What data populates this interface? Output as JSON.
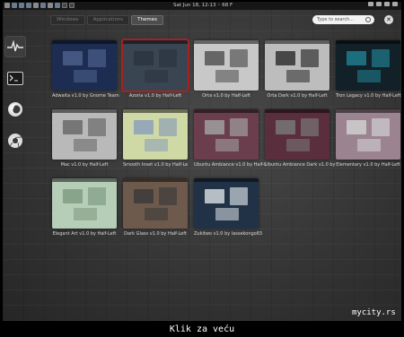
{
  "topbar": {
    "clock": "Sat Jun 18, 12:13 ◦ 68 F"
  },
  "tabs": [
    {
      "label": "Windows"
    },
    {
      "label": "Applications"
    },
    {
      "label": "Themes"
    }
  ],
  "search": {
    "placeholder": "Type to search..."
  },
  "close_label": "✕",
  "themes": [
    {
      "caption": "Adwaita v1.0 by Gnome Team",
      "bg": "#1d2d52",
      "accent": "#4a5f8a",
      "selected": false
    },
    {
      "caption": "Azoria v1.0 by Half-Left",
      "bg": "#3a4552",
      "accent": "#2b3441",
      "selected": true
    },
    {
      "caption": "Orta v1.0 by Half-Left",
      "bg": "#c8c8c8",
      "accent": "#555",
      "selected": false
    },
    {
      "caption": "Orta Dark v1.0 by Half-Left",
      "bg": "#bdbdbd",
      "accent": "#333",
      "selected": false
    },
    {
      "caption": "Tron Legacy v1.0 by Half-Left",
      "bg": "#122028",
      "accent": "#1f7d8e",
      "selected": false
    },
    {
      "caption": "Mac v1.0 by Half-Left",
      "bg": "#b9b9b9",
      "accent": "#6a6a6a",
      "selected": false
    },
    {
      "caption": "Smooth Inset v1.0 by Half-Le",
      "bg": "#cfd9a6",
      "accent": "#8da0b8",
      "selected": false
    },
    {
      "caption": "Ubuntu Ambiance v1.0 by Half-L",
      "bg": "#6b3e4e",
      "accent": "#a0a0a0",
      "selected": false
    },
    {
      "caption": "Ubuntu Ambiance Dark v1.0 by",
      "bg": "#5a2e3d",
      "accent": "#777",
      "selected": false
    },
    {
      "caption": "Elementary v1.0 by Half-Left",
      "bg": "#9b8390",
      "accent": "#d0d0d0",
      "selected": false
    },
    {
      "caption": "Elegant Art v1.0 by Half-Left",
      "bg": "#b6cdb7",
      "accent": "#809c84",
      "selected": false
    },
    {
      "caption": "Dark Glass v1.0 by Half-Left",
      "bg": "#6e5a4c",
      "accent": "#3d3b3b",
      "selected": false
    },
    {
      "caption": "Zukitwo v1.0 by lassekongo83",
      "bg": "#223246",
      "accent": "#cfd6dc",
      "selected": false
    }
  ],
  "watermark": "mycity.rs",
  "footer": "Klik za veću"
}
